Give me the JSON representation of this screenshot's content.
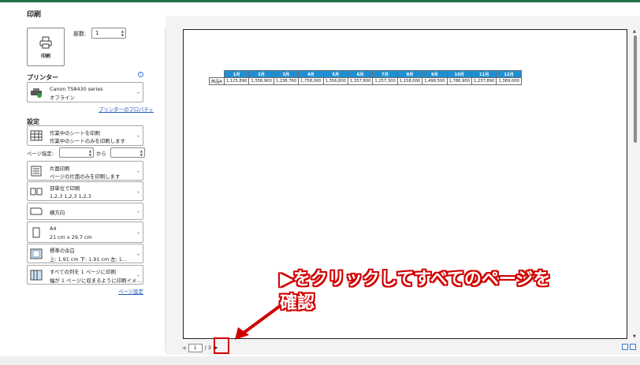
{
  "page": {
    "title": "印刷"
  },
  "print_button": {
    "label": "印刷",
    "icon": "printer-icon"
  },
  "copies": {
    "label": "部数:",
    "value": "1"
  },
  "printer": {
    "section_title": "プリンター",
    "name": "Canon TS8430 series",
    "status": "オフライン",
    "properties_link": "プリンターのプロパティ"
  },
  "settings": {
    "section_title": "設定",
    "what_to_print": {
      "line1": "作業中のシートを印刷",
      "line2": "作業中のシートのみを印刷します"
    },
    "pages": {
      "label": "ページ指定:",
      "from_label": "から",
      "from_value": "",
      "to_value": ""
    },
    "sides": {
      "line1": "片面印刷",
      "line2": "ページの片面のみを印刷します"
    },
    "collation": {
      "line1": "部単位で印刷",
      "line2": "1,2,3    1,2,3    1,2,3"
    },
    "orientation": {
      "line1": "横方向"
    },
    "paper_size": {
      "line1": "A4",
      "line2": "21 cm x 29.7 cm"
    },
    "margins": {
      "line1": "標準の余白",
      "line2": "上: 1.91 cm 下: 1.91 cm 左: 1..."
    },
    "scaling": {
      "line1": "すべての列を 1 ページに印刷",
      "line2": "幅が 1 ページに収まるように印刷イメ..."
    },
    "page_setup_link": "ページ設定"
  },
  "preview_table": {
    "months": [
      "1月",
      "2月",
      "3月",
      "4月",
      "5月",
      "6月",
      "7月",
      "8月",
      "9月",
      "10月",
      "11月",
      "12月"
    ],
    "row_label": "商品A",
    "values": [
      "1,125,890",
      "1,358,900",
      "1,238,760",
      "1,758,000",
      "1,356,800",
      "1,357,800",
      "1,257,300",
      "1,158,000",
      "1,498,500",
      "1,786,900",
      "1,237,890",
      "1,389,000"
    ]
  },
  "navigation": {
    "current_page": "1",
    "separator": "/ 3"
  },
  "annotation": {
    "line1": "▶をクリックしてすべてのページを",
    "line2": "確認"
  },
  "colors": {
    "accent": "#217346",
    "table_header": "#1f8fd4",
    "callout": "#d10000",
    "link": "#1e57b8"
  }
}
